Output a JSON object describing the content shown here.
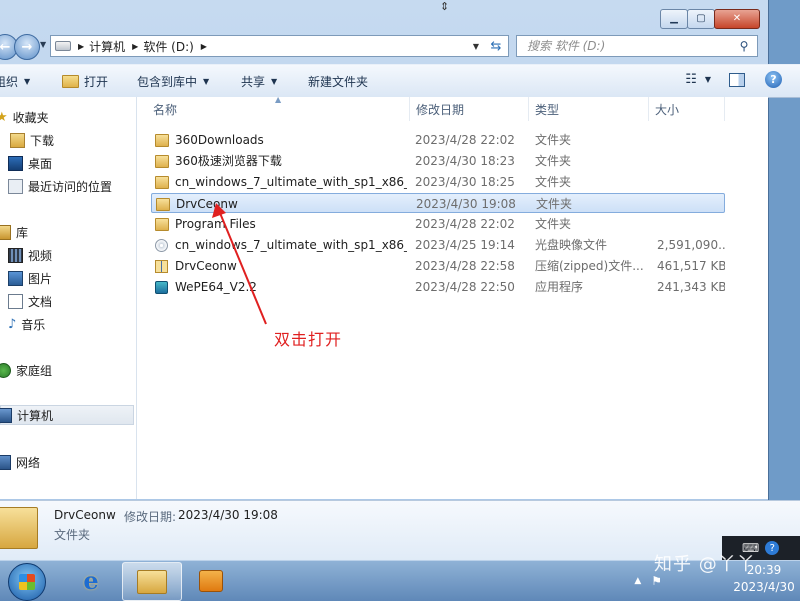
{
  "address": {
    "crumbs": [
      "计算机",
      "软件 (D:)"
    ]
  },
  "search": {
    "placeholder": "搜索 软件 (D:)"
  },
  "toolbar": {
    "organize": "组织",
    "open": "打开",
    "include": "包含到库中",
    "share": "共享",
    "new_folder": "新建文件夹"
  },
  "nav": {
    "favorites": "收藏夹",
    "downloads": "下载",
    "desktop": "桌面",
    "recent": "最近访问的位置",
    "libraries": "库",
    "videos": "视频",
    "pictures": "图片",
    "documents": "文档",
    "music": "音乐",
    "homegroup": "家庭组",
    "computer": "计算机",
    "network": "网络"
  },
  "columns": {
    "name": "名称",
    "date": "修改日期",
    "type": "类型",
    "size": "大小"
  },
  "files": [
    {
      "name": "360Downloads",
      "date": "2023/4/28 22:02",
      "type": "文件夹",
      "size": "",
      "icon": "folder"
    },
    {
      "name": "360极速浏览器下载",
      "date": "2023/4/30 18:23",
      "type": "文件夹",
      "size": "",
      "icon": "folder"
    },
    {
      "name": "cn_windows_7_ultimate_with_sp1_x86_...",
      "date": "2023/4/30 18:25",
      "type": "文件夹",
      "size": "",
      "icon": "folder"
    },
    {
      "name": "DrvCeonw",
      "date": "2023/4/30 19:08",
      "type": "文件夹",
      "size": "",
      "icon": "folder",
      "selected": true
    },
    {
      "name": "Program Files",
      "date": "2023/4/28 22:02",
      "type": "文件夹",
      "size": "",
      "icon": "folder"
    },
    {
      "name": "cn_windows_7_ultimate_with_sp1_x86_...",
      "date": "2023/4/25 19:14",
      "type": "光盘映像文件",
      "size": "2,591,090...",
      "icon": "iso"
    },
    {
      "name": "DrvCeonw",
      "date": "2023/4/28 22:58",
      "type": "压缩(zipped)文件...",
      "size": "461,517 KB",
      "icon": "zip"
    },
    {
      "name": "WePE64_V2.2",
      "date": "2023/4/28 22:50",
      "type": "应用程序",
      "size": "241,343 KB",
      "icon": "exe"
    }
  ],
  "annotation": {
    "text": "双击打开",
    "color": "#e02020"
  },
  "details": {
    "name": "DrvCeonw",
    "date_label": "修改日期:",
    "date_value": "2023/4/30 19:08",
    "type": "文件夹"
  },
  "taskbar": {
    "watermark": "知乎 @丫丫",
    "time": "20:39",
    "date": "2023/4/30"
  }
}
